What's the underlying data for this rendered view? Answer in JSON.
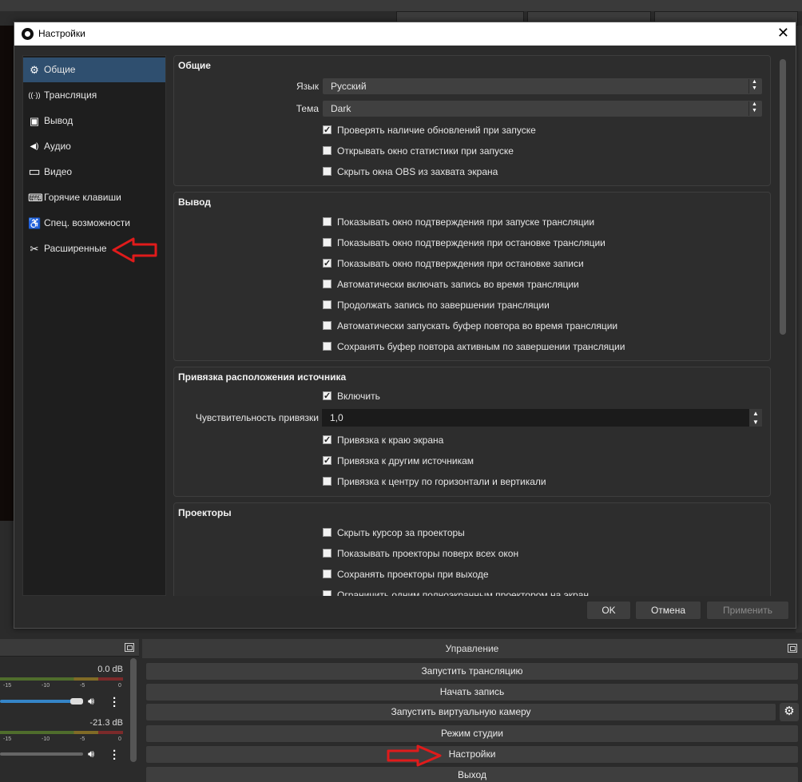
{
  "dialog": {
    "title": "Настройки",
    "close_label": "✕"
  },
  "sidebar": {
    "items": [
      {
        "label": "Общие",
        "icon": "gear-icon",
        "glyph": "⚙"
      },
      {
        "label": "Трансляция",
        "icon": "antenna-icon",
        "glyph": "((·))"
      },
      {
        "label": "Вывод",
        "icon": "output-icon",
        "glyph": "▣"
      },
      {
        "label": "Аудио",
        "icon": "speaker-icon",
        "glyph": "◀)"
      },
      {
        "label": "Видео",
        "icon": "monitor-icon",
        "glyph": "▭"
      },
      {
        "label": "Горячие клавиши",
        "icon": "keyboard-icon",
        "glyph": "⌨"
      },
      {
        "label": "Спец. возможности",
        "icon": "accessibility-icon",
        "glyph": "♿"
      },
      {
        "label": "Расширенные",
        "icon": "tools-icon",
        "glyph": "✂"
      }
    ]
  },
  "general": {
    "title": "Общие",
    "language_label": "Язык",
    "language_value": "Русский",
    "theme_label": "Тема",
    "theme_value": "Dark",
    "checks": [
      {
        "label": "Проверять наличие обновлений при запуске",
        "checked": true
      },
      {
        "label": "Открывать окно статистики при запуске",
        "checked": false
      },
      {
        "label": "Скрыть окна OBS из захвата экрана",
        "checked": false
      }
    ]
  },
  "output": {
    "title": "Вывод",
    "checks": [
      {
        "label": "Показывать окно подтверждения при запуске трансляции",
        "checked": false
      },
      {
        "label": "Показывать окно подтверждения при остановке трансляции",
        "checked": false
      },
      {
        "label": "Показывать окно подтверждения при остановке записи",
        "checked": true
      },
      {
        "label": "Автоматически включать запись во время трансляции",
        "checked": false
      },
      {
        "label": "Продолжать запись по завершении трансляции",
        "checked": false
      },
      {
        "label": "Автоматически запускать буфер повтора во время трансляции",
        "checked": false
      },
      {
        "label": "Сохранять буфер повтора активным по завершении трансляции",
        "checked": false
      }
    ]
  },
  "snapping": {
    "title": "Привязка расположения источника",
    "enable_label": "Включить",
    "enable_checked": true,
    "sensitivity_label": "Чувствительность привязки",
    "sensitivity_value": "1,0",
    "checks": [
      {
        "label": "Привязка к краю экрана",
        "checked": true
      },
      {
        "label": "Привязка к другим источникам",
        "checked": true
      },
      {
        "label": "Привязка к центру по горизонтали и вертикали",
        "checked": false
      }
    ]
  },
  "projectors": {
    "title": "Проекторы",
    "checks": [
      {
        "label": "Скрыть курсор за проекторы",
        "checked": false
      },
      {
        "label": "Показывать проекторы поверх всех окон",
        "checked": false
      },
      {
        "label": "Сохранять проекторы при выходе",
        "checked": false
      },
      {
        "label": "Ограничить одним полноэкранным проектором на экран",
        "checked": false
      }
    ]
  },
  "buttons": {
    "ok": "OK",
    "cancel": "Отмена",
    "apply": "Применить"
  },
  "mixer": {
    "track1_db": "0.0 dB",
    "track2_db": "-21.3 dB",
    "scale": [
      "-15",
      "-10",
      "-5",
      "0"
    ]
  },
  "controls": {
    "title": "Управление",
    "buttons": [
      "Запустить трансляцию",
      "Начать запись",
      "Запустить виртуальную камеру",
      "Режим студии",
      "Настройки",
      "Выход"
    ]
  },
  "colors": {
    "accent_selected": "#2f4f6f",
    "annotation_arrow": "#e01b1b"
  }
}
